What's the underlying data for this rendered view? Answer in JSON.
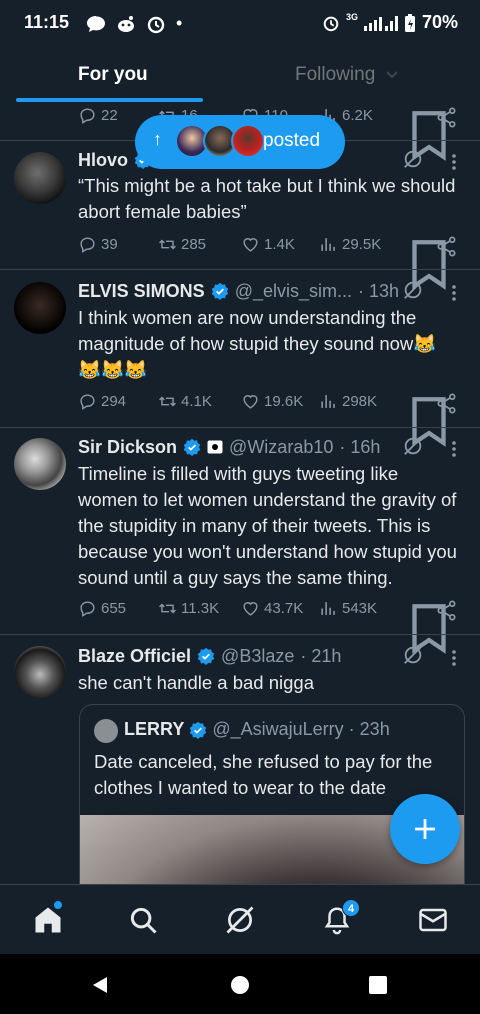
{
  "status_bar": {
    "time": "11:15",
    "network": "3G",
    "battery": "70%"
  },
  "tabs": {
    "for_you": "For you",
    "following": "Following"
  },
  "new_posts_pill": {
    "label": "posted"
  },
  "partial_tweet": {
    "replies": "22",
    "retweets": "16",
    "likes": "110",
    "views": "6.2K"
  },
  "tweets": [
    {
      "name": "Hlovo",
      "handle": "",
      "time": "",
      "text": "“This might be a hot take but I think we should abort female babies”",
      "replies": "39",
      "retweets": "285",
      "likes": "1.4K",
      "views": "29.5K"
    },
    {
      "name": "ELVIS SIMONS",
      "handle": "@_elvis_sim...",
      "time": "· 13h",
      "text": "I think women are now understanding the magnitude of how stupid they sound now😹 😹😹😹",
      "replies": "294",
      "retweets": "4.1K",
      "likes": "19.6K",
      "views": "298K"
    },
    {
      "name": "Sir Dickson",
      "handle": "@Wizarab10",
      "time": "· 16h",
      "text": "Timeline is filled with guys tweeting like women to let women understand the gravity of the stupidity in many of their tweets. This is because you won't understand how stupid you sound until a guy says the same thing.",
      "replies": "655",
      "retweets": "11.3K",
      "likes": "43.7K",
      "views": "543K"
    },
    {
      "name": "Blaze Officiel",
      "handle": "@B3laze",
      "time": "· 21h",
      "text": "she can't handle a bad nigga"
    }
  ],
  "quoted_tweet": {
    "name": "LERRY",
    "handle": "@_AsiwajuLerry",
    "time": "· 23h",
    "text": "Date canceled, she refused to pay for the clothes I wanted to wear to the date"
  },
  "bottom_nav": {
    "notification_count": "4"
  },
  "icons": [
    "chat-bubble-icon",
    "reddit-icon",
    "alarm-icon",
    "signal-icon",
    "battery-icon",
    "chevron-down-icon",
    "reply-icon",
    "retweet-icon",
    "like-icon",
    "views-icon",
    "bookmark-icon",
    "share-icon",
    "verified-icon",
    "grok-icon",
    "more-icon",
    "plus-icon",
    "home-icon",
    "search-icon",
    "bell-icon",
    "mail-icon",
    "back-icon",
    "home-circle-icon",
    "recents-icon"
  ],
  "colors": {
    "background": "#15202b",
    "accent": "#1d9bf0",
    "muted": "#8b98a5",
    "divider": "#38444d"
  }
}
